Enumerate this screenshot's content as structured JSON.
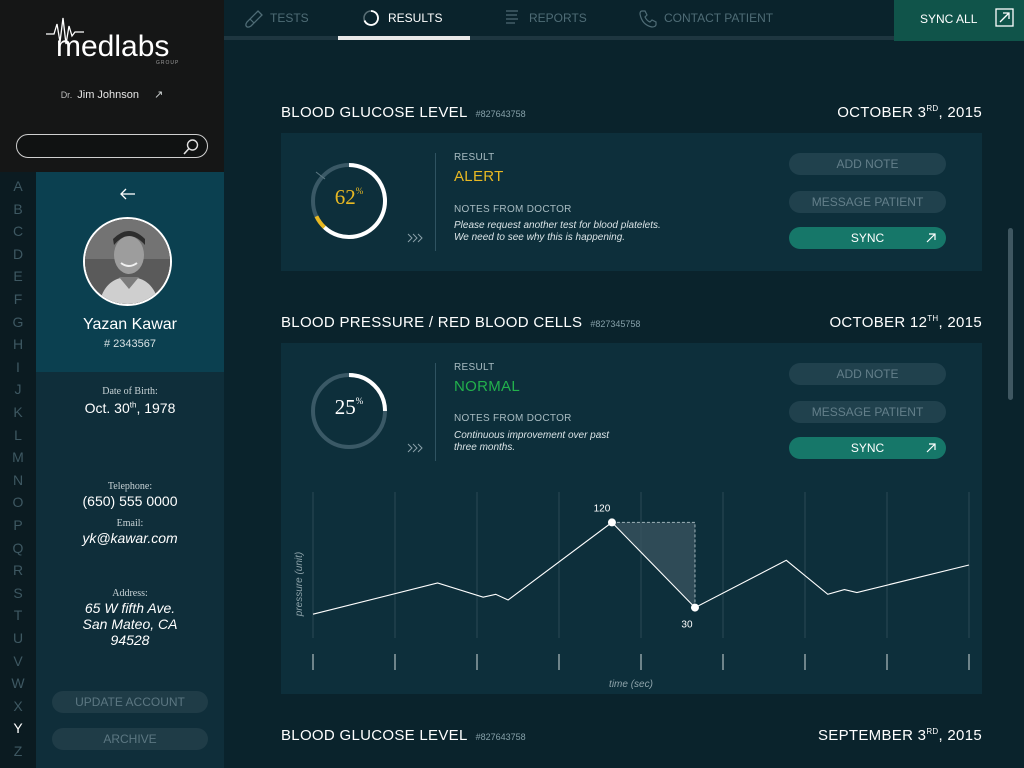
{
  "brand": {
    "logo_text": "medlabs",
    "logo_sub": "GROUP",
    "doctor_prefix": "Dr.",
    "doctor_name": "Jim Johnson"
  },
  "search": {
    "value": "",
    "placeholder": ""
  },
  "alphabet": [
    "A",
    "B",
    "C",
    "D",
    "E",
    "F",
    "G",
    "H",
    "I",
    "J",
    "K",
    "L",
    "M",
    "N",
    "O",
    "P",
    "Q",
    "R",
    "S",
    "T",
    "U",
    "V",
    "W",
    "X",
    "Y",
    "Z"
  ],
  "alphabet_active": "Y",
  "patient": {
    "name": "Yazan Kawar",
    "id": "# 2343567",
    "dob_label": "Date of Birth:",
    "dob_day": "Oct. 30",
    "dob_suffix": "th",
    "dob_year": ", 1978",
    "phone_label": "Telephone:",
    "phone": "(650) 555 0000",
    "email_label": "Email:",
    "email": "yk@kawar.com",
    "address_label": "Address:",
    "address_line1": "65 W fifth Ave.",
    "address_line2": "San Mateo, CA",
    "address_line3": "94528",
    "update_label": "UPDATE ACCOUNT",
    "archive_label": "ARCHIVE"
  },
  "nav": {
    "tabs": [
      {
        "label": "TESTS",
        "icon": "test-tube-icon"
      },
      {
        "label": "RESULTS",
        "icon": "results-ring-icon",
        "active": true
      },
      {
        "label": "REPORTS",
        "icon": "reports-list-icon"
      },
      {
        "label": "CONTACT PATIENT",
        "icon": "phone-icon"
      }
    ],
    "sync_all_label": "SYNC ALL"
  },
  "results": [
    {
      "title": "BLOOD GLUCOSE LEVEL",
      "ref": "#827643758",
      "date_month_day": "OCTOBER 3",
      "date_suffix": "RD",
      "date_year": ", 2015",
      "percent": 62,
      "percent_text": "62",
      "percent_sign": "%",
      "result_label": "RESULT",
      "status": "ALERT",
      "status_color": "#e8b923",
      "notes_label": "NOTES FROM DOCTOR",
      "notes_line1": "Please request another test for blood platelets.",
      "notes_line2": "We need to see why this is happening.",
      "add_note_label": "ADD NOTE",
      "message_label": "MESSAGE PATIENT",
      "sync_label": "SYNC"
    },
    {
      "title": "BLOOD PRESSURE / RED BLOOD CELLS",
      "ref": "#827345758",
      "date_month_day": "OCTOBER 12",
      "date_suffix": "TH",
      "date_year": ", 2015",
      "percent": 25,
      "percent_text": "25",
      "percent_sign": "%",
      "result_label": "RESULT",
      "status": "NORMAL",
      "status_color": "#22b14c",
      "notes_label": "NOTES FROM DOCTOR",
      "notes_line1": "Continuous improvement over past",
      "notes_line2": "three months.",
      "add_note_label": "ADD NOTE",
      "message_label": "MESSAGE PATIENT",
      "sync_label": "SYNC"
    },
    {
      "title": "BLOOD GLUCOSE LEVEL",
      "ref": "#827643758",
      "date_month_day": "SEPTEMBER 3",
      "date_suffix": "RD",
      "date_year": ", 2015"
    }
  ],
  "chart_data": {
    "type": "line",
    "xlabel": "time (sec)",
    "ylabel": "pressure (unit)",
    "ylim": [
      0,
      150
    ],
    "series": [
      {
        "values": [
          [
            0,
            23
          ],
          [
            1.5,
            56
          ],
          [
            2.05,
            41
          ],
          [
            2.2,
            44
          ],
          [
            2.35,
            38
          ],
          [
            3.6,
            120
          ],
          [
            4.6,
            30
          ],
          [
            5.7,
            80
          ],
          [
            6.2,
            44
          ],
          [
            6.4,
            49
          ],
          [
            6.55,
            46
          ],
          [
            7.9,
            75
          ]
        ]
      }
    ],
    "highlight": {
      "from_value": 120,
      "to_value": 30,
      "from_label": "120",
      "to_label": "30"
    },
    "grid": "vertical",
    "xlim": [
      0,
      7.9
    ]
  }
}
